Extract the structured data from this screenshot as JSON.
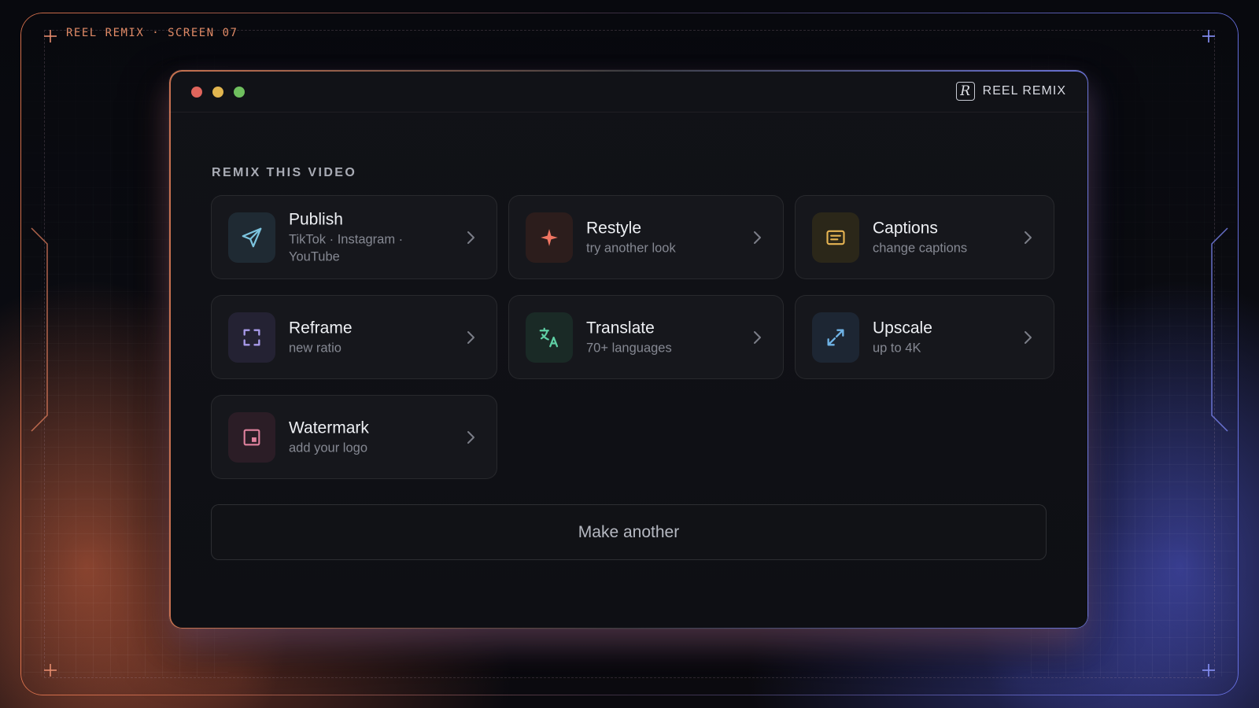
{
  "screen_tag": "REEL REMIX · SCREEN 07",
  "window": {
    "brand": {
      "logo_letter": "R",
      "name": "REEL REMIX"
    }
  },
  "section_title": "REMIX THIS VIDEO",
  "options": [
    {
      "title": "Publish",
      "subtitle": "TikTok · Instagram · YouTube",
      "icon": "send-icon",
      "accent": "#7cc4df"
    },
    {
      "title": "Restyle",
      "subtitle": "try another look",
      "icon": "sparkle-icon",
      "accent": "#f07562"
    },
    {
      "title": "Captions",
      "subtitle": "change captions",
      "icon": "captions-icon",
      "accent": "#e7b553"
    },
    {
      "title": "Reframe",
      "subtitle": "new ratio",
      "icon": "reframe-icon",
      "accent": "#a99bea"
    },
    {
      "title": "Translate",
      "subtitle": "70+ languages",
      "icon": "translate-icon",
      "accent": "#5fd0a5"
    },
    {
      "title": "Upscale",
      "subtitle": "up to 4K",
      "icon": "expand-icon",
      "accent": "#6fb3e6"
    },
    {
      "title": "Watermark",
      "subtitle": "add your logo",
      "icon": "watermark-icon",
      "accent": "#e0829e"
    }
  ],
  "make_another_label": "Make another",
  "colors": {
    "background": "#07080c",
    "window": "#111217",
    "card": "#16171c",
    "frame_left_accent": "#e6784f",
    "frame_right_accent": "#6e78f0"
  }
}
